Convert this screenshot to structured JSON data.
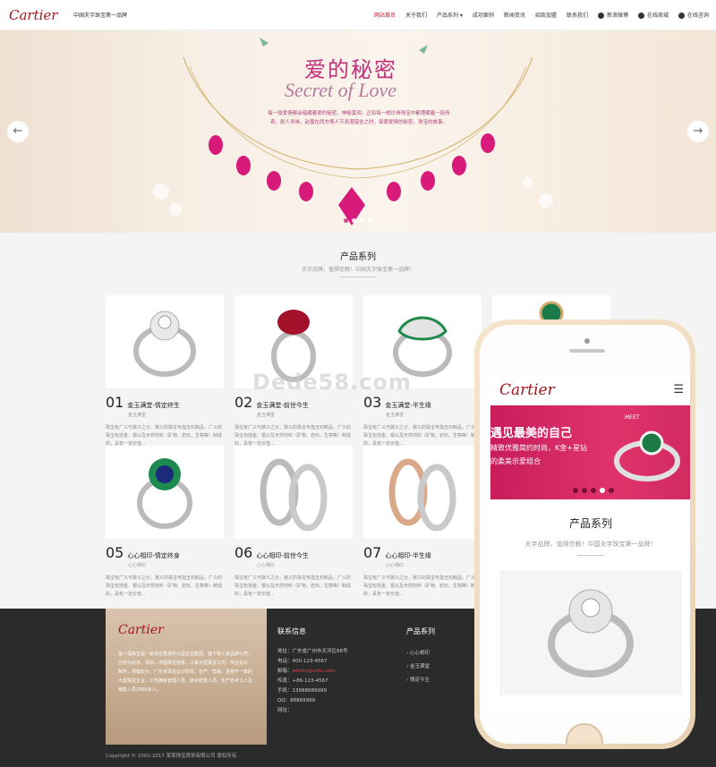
{
  "header": {
    "logo": "Cartier",
    "slogan": "中国夫字珠宝第一品牌",
    "nav": [
      {
        "label": "网站首页",
        "active": true
      },
      {
        "label": "关于我们"
      },
      {
        "label": "产品系列 ▾"
      },
      {
        "label": "成功案例"
      },
      {
        "label": "新闻资讯"
      },
      {
        "label": "招商加盟"
      },
      {
        "label": "联系我们"
      }
    ],
    "utilities": [
      {
        "icon": "weibo-icon",
        "label": "新浪微博"
      },
      {
        "icon": "cart-icon",
        "label": "在线商城"
      },
      {
        "icon": "chat-icon",
        "label": "在线咨询"
      }
    ]
  },
  "banner": {
    "title": "爱的秘密",
    "subtitle": "Secret of Love",
    "text": "每一段爱情都会蕴藏着爱的秘密，神秘莫测。正如每一枚珍贵珠宝中都埋藏着一段传奇，耐人寻味。赵嘉在西方情人节浪漫蕴含之时，探索爱情的秘密，珠宝的故事。",
    "arrow_left": "←",
    "arrow_right": "→",
    "slides": 4,
    "active_slide": 0
  },
  "products": {
    "title": "产品系列",
    "subtitle": "夫字品牌，值得信赖！中国夫字珠宝第一品牌！",
    "items": [
      {
        "num": "01",
        "name": "金玉满堂-情定终生",
        "category": "金玉满堂",
        "desc": "珠宝有广义与狭义之分，狭义的珠宝专指玉石制品，广义的珠宝包括金、银以及天然材料（矿物、岩石、生物等）制成的，具有一定价值..."
      },
      {
        "num": "02",
        "name": "金玉满堂-前世今生",
        "category": "金玉满堂",
        "desc": "珠宝有广义与狭义之分，狭义的珠宝专指玉石制品，广义的珠宝包括金、银以及天然材料（矿物、岩石、生物等）制成的，具有一定价值..."
      },
      {
        "num": "03",
        "name": "金玉满堂-半生缘",
        "category": "金玉满堂",
        "desc": "珠宝有广义与狭义之分，狭义的珠宝专指玉石制品，广义的珠宝包括金、银以及天然材料（矿物、岩石、生物等）制成的，具有一定价值..."
      },
      {
        "num": "05",
        "name": "心心相印-情定终身",
        "category": "心心相印",
        "desc": "珠宝有广义与狭义之分，狭义的珠宝专指玉石制品，广义的珠宝包括金、银以及天然材料（矿物、岩石、生物等）制成的，具有一定价值..."
      },
      {
        "num": "06",
        "name": "心心相印-前世今生",
        "category": "心心相印",
        "desc": "珠宝有广义与狭义之分，狭义的珠宝专指玉石制品，广义的珠宝包括金、银以及天然材料（矿物、岩石、生物等）制成的，具有一定价值..."
      },
      {
        "num": "07",
        "name": "心心相印-半生缘",
        "category": "心心相印",
        "desc": "珠宝有广义与狭义之分，狭义的珠宝专指玉石制品，广义的珠宝包括金、银以及天然材料（矿物、岩石、生物等）制成的，具有一定价值..."
      }
    ]
  },
  "watermark": "Dede58.com",
  "footer": {
    "about_logo": "Cartier",
    "about_text": "金八福珠宝是一家来自香港的大型企业集团，旗下有三家品牌公司，分别为北京、深圳，中国珠宝首家，三家大型珠宝公司，专业设计、制作，规模宏大，广东省珠宝设计研发、生产、营销、连锁于一体的大型珠宝企业。公司拥有管理人员、技术研发人员、生产技术工人及销售人员2000多人。",
    "contact_title": "联系信息",
    "contact": [
      {
        "label": "地址：",
        "value": "广东省广州市天河区88号"
      },
      {
        "label": "电话：",
        "value": "400-123-4567"
      },
      {
        "label": "邮箱：",
        "value": "admin@aidu.com"
      },
      {
        "label": "传真：",
        "value": "+86-123-4567"
      },
      {
        "label": "手机：",
        "value": "13988889999"
      },
      {
        "label": "QQ：",
        "value": "88889999"
      },
      {
        "label": "网址：",
        "value": ""
      }
    ],
    "products_title": "产品系列",
    "products": [
      "心心相印",
      "金玉满堂",
      "情定今生"
    ],
    "copyright": "Copyright © 2002-2017 某某珠宝首饰有限公司 版权所有"
  },
  "mobile": {
    "logo": "Cartier",
    "menu_icon": "☰",
    "banner_line1": "遇见最美的自己",
    "banner_line2": "精致优雅简约时尚，K金+星钻",
    "banner_line3": "的柔美示爱组合",
    "banner_tag": "MEET",
    "slides": 5,
    "active_slide": 3,
    "title": "产品系列",
    "subtitle": "夫字品牌，值得信赖！中国夫字珠宝第一品牌！"
  },
  "colors": {
    "brand": "#a4141c",
    "accent": "#c2307c",
    "footer_bg": "#2b2b2b"
  }
}
